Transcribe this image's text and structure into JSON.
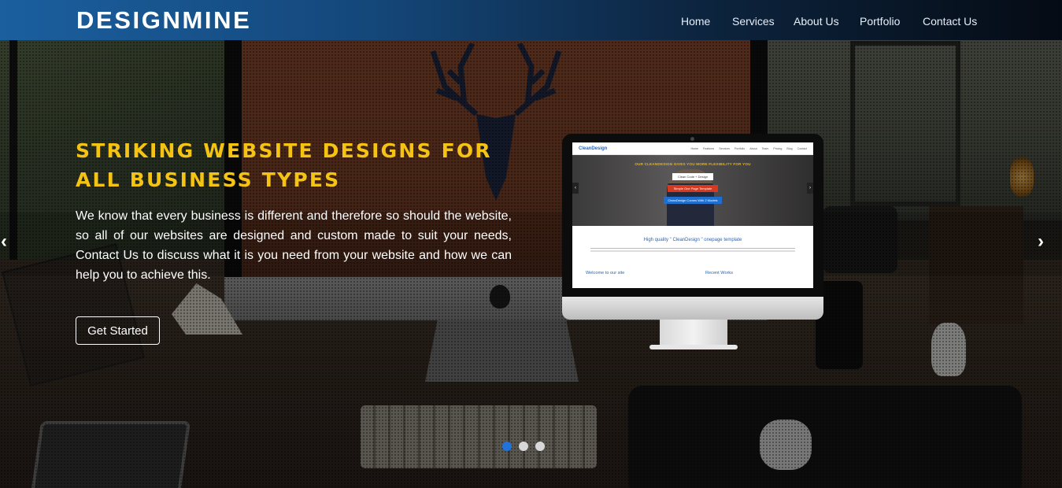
{
  "brand": {
    "name": "DESIGNMINE"
  },
  "nav": {
    "items": [
      {
        "label": "Home"
      },
      {
        "label": "Services"
      },
      {
        "label": "About Us"
      },
      {
        "label": "Portfolio"
      },
      {
        "label": "Contact Us"
      }
    ]
  },
  "hero": {
    "headline_line1": "STRIKING WEBSITE DESIGNS FOR",
    "headline_line2": "ALL BUSINESS TYPES",
    "description": "We know that every business is different and therefore so should the website, so all of our websites are designed and custom made to suit your needs, Contact Us to discuss what it is you need from your website and how we can help you to achieve this.",
    "cta_label": "Get Started",
    "prev_icon": "chevron-left-icon",
    "next_icon": "chevron-right-icon",
    "slides": {
      "count": 3,
      "active_index": 0
    }
  },
  "mockup": {
    "logo": "CleanDesign",
    "nav_links": [
      "Home",
      "Features",
      "Services",
      "Portfolio",
      "About",
      "Team",
      "Pricing",
      "Blog",
      "Contact"
    ],
    "tagline": "OUR CLEANDESIGN GIVES YOU MORE FLEXIBILITY FOR YOU",
    "button1": "Clean Code + Design",
    "button2": "Simple One Page Template",
    "button3": "CleanDesign Comes With 2 Models",
    "heading": "High quality \" CleanDesign \" onepage template",
    "col1": "Welcome to our site",
    "col2": "Recent Works"
  },
  "colors": {
    "headline": "#f5c313",
    "dot_active": "#1f73d9",
    "dot_inactive": "#d8d8d8",
    "header_start": "#1b5f9f",
    "header_end": "#050b14"
  }
}
